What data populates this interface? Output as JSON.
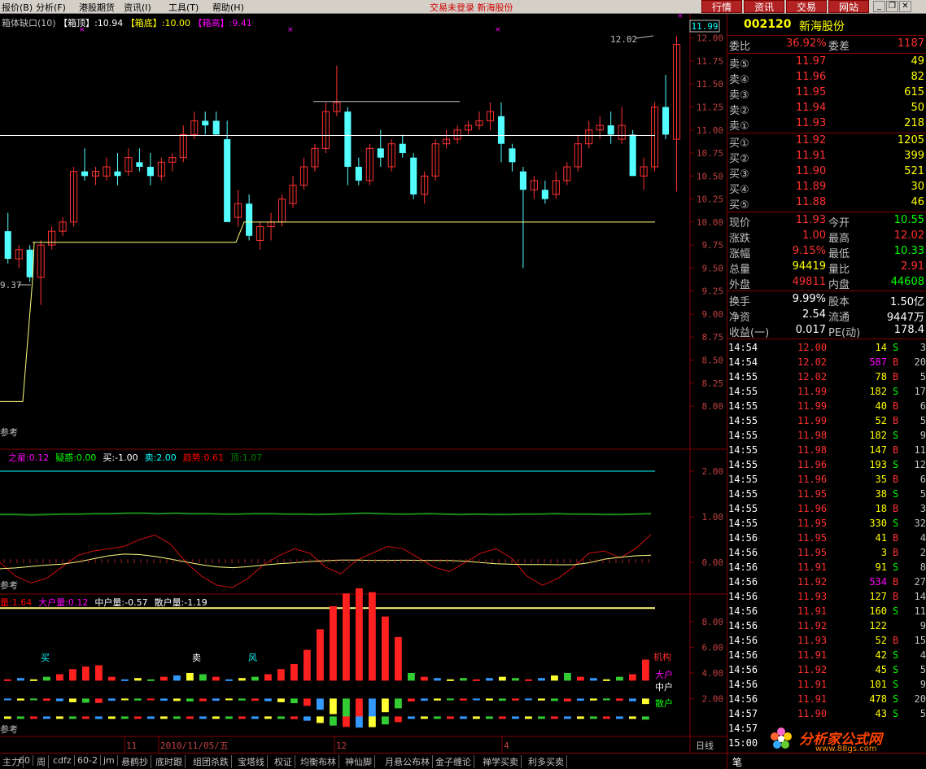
{
  "menu": {
    "items": [
      "报价(B)",
      "分析(F)",
      "港股期货",
      "资讯(I)",
      "工具(T)",
      "帮助(H)"
    ],
    "status_text": "交易未登录  新海股份",
    "top_buttons": [
      "行情",
      "资讯",
      "交易",
      "网站"
    ]
  },
  "main_panel": {
    "legend": {
      "name": "箱体缺口(10)",
      "box_top_label": "【箱顶】",
      "box_top_value": ":10.94",
      "box_bottom_label": "【箱底】",
      "box_bottom_value": ":10.00",
      "box_high_label": "【箱高】",
      "box_high_value": ":9.41"
    },
    "y_ticks": [
      "12.00",
      "11.75",
      "11.50",
      "11.25",
      "11.00",
      "10.75",
      "10.50",
      "10.25",
      "10.00",
      "9.75",
      "9.50",
      "9.25",
      "9.00",
      "8.75",
      "8.50",
      "8.25",
      "8.00"
    ],
    "current_price_tag": "11.99",
    "peak_annotation": "12.02",
    "low_annotation": "9.37",
    "ref_label": "参考"
  },
  "indicator1": {
    "legend": [
      {
        "text": "之星:0.12",
        "color": "#ff00ff"
      },
      {
        "text": "疑惑:0.00",
        "color": "#00ff00"
      },
      {
        "text": "买:-1.00",
        "color": "#ffffff"
      },
      {
        "text": "卖:2.00",
        "color": "#00ffff"
      },
      {
        "text": "趋势:0.61",
        "color": "#ff0000"
      },
      {
        "text": "顶:1.07",
        "color": "#008000"
      }
    ],
    "y_ticks": [
      "2.00",
      "1.00",
      "0.00"
    ],
    "ref_label": "参考"
  },
  "indicator2": {
    "legend": [
      {
        "text": "量:1.64",
        "color": "#ff0000"
      },
      {
        "text": "大户量:0.12",
        "color": "#ff00ff"
      },
      {
        "text": "中户量:-0.57",
        "color": "#ffffff"
      },
      {
        "text": "散户量:-1.19",
        "color": "#ffffff"
      }
    ],
    "y_ticks": [
      "8.00",
      "6.00",
      "4.00",
      "2.00"
    ],
    "labels": {
      "buy": "买",
      "sell": "卖",
      "risk": "风",
      "inst": "机构",
      "big": "大户",
      "mid": "中户",
      "retail": "散户"
    },
    "ref_label": "参考"
  },
  "x_axis": {
    "labels": [
      "11",
      "2010/11/05/五",
      "12",
      "4"
    ],
    "period": "日线"
  },
  "tabs": [
    "主力",
    "60",
    "周",
    "cdfz",
    "60-2",
    "jm",
    "悬鹤抄",
    "底时跟",
    "组团杀跌",
    "宝塔线",
    "权证",
    "均衡布林",
    "神仙脚",
    "月悬公布林",
    "金子缠论",
    "禅学买卖",
    "利多买卖"
  ],
  "quote": {
    "code": "002120",
    "name": "新海股份",
    "weibi_label": "委比",
    "weibi_value": "36.92%",
    "weicha_label": "委差",
    "weicha_value": "1187",
    "asks": [
      {
        "label": "卖⑤",
        "price": "11.97",
        "vol": "49"
      },
      {
        "label": "卖④",
        "price": "11.96",
        "vol": "82"
      },
      {
        "label": "卖③",
        "price": "11.95",
        "vol": "615"
      },
      {
        "label": "卖②",
        "price": "11.94",
        "vol": "50"
      },
      {
        "label": "卖①",
        "price": "11.93",
        "vol": "218"
      }
    ],
    "bids": [
      {
        "label": "买①",
        "price": "11.92",
        "vol": "1205"
      },
      {
        "label": "买②",
        "price": "11.91",
        "vol": "399"
      },
      {
        "label": "买③",
        "price": "11.90",
        "vol": "521"
      },
      {
        "label": "买④",
        "price": "11.89",
        "vol": "30"
      },
      {
        "label": "买⑤",
        "price": "11.88",
        "vol": "46"
      }
    ],
    "stats": [
      {
        "l1": "现价",
        "v1": "11.93",
        "c1": "#ff3030",
        "l2": "今开",
        "v2": "10.55",
        "c2": "#00ff00"
      },
      {
        "l1": "涨跌",
        "v1": "1.00",
        "c1": "#ff3030",
        "l2": "最高",
        "v2": "12.02",
        "c2": "#ff3030"
      },
      {
        "l1": "涨幅",
        "v1": "9.15%",
        "c1": "#ff3030",
        "l2": "最低",
        "v2": "10.33",
        "c2": "#00ff00"
      },
      {
        "l1": "总量",
        "v1": "94419",
        "c1": "#ffff00",
        "l2": "量比",
        "v2": "2.91",
        "c2": "#ff3030"
      },
      {
        "l1": "外盘",
        "v1": "49811",
        "c1": "#ff3030",
        "l2": "内盘",
        "v2": "44608",
        "c2": "#00ff00"
      }
    ],
    "fund": [
      {
        "l1": "换手",
        "v1": "9.99%",
        "l2": "股本",
        "v2": "1.50亿"
      },
      {
        "l1": "净资",
        "v1": "2.54",
        "l2": "流通",
        "v2": "9447万"
      },
      {
        "l1": "收益(一)",
        "v1": "0.017",
        "l2": "PE(动)",
        "v2": "178.4"
      }
    ],
    "ticks": [
      {
        "t": "14:54",
        "p": "12.00",
        "v": "14",
        "vc": "#ffff00",
        "s": "S",
        "sc": "#00ff00",
        "n": "3"
      },
      {
        "t": "14:54",
        "p": "12.02",
        "v": "587",
        "vc": "#ff00ff",
        "s": "B",
        "sc": "#ff3030",
        "n": "20"
      },
      {
        "t": "14:55",
        "p": "12.02",
        "v": "78",
        "vc": "#ffff00",
        "s": "B",
        "sc": "#ff3030",
        "n": "5"
      },
      {
        "t": "14:55",
        "p": "11.99",
        "v": "182",
        "vc": "#ffff00",
        "s": "S",
        "sc": "#00ff00",
        "n": "17"
      },
      {
        "t": "14:55",
        "p": "11.99",
        "v": "40",
        "vc": "#ffff00",
        "s": "B",
        "sc": "#ff3030",
        "n": "6"
      },
      {
        "t": "14:55",
        "p": "11.99",
        "v": "52",
        "vc": "#ffff00",
        "s": "B",
        "sc": "#ff3030",
        "n": "5"
      },
      {
        "t": "14:55",
        "p": "11.98",
        "v": "182",
        "vc": "#ffff00",
        "s": "S",
        "sc": "#00ff00",
        "n": "9"
      },
      {
        "t": "14:55",
        "p": "11.98",
        "v": "147",
        "vc": "#ffff00",
        "s": "B",
        "sc": "#ff3030",
        "n": "11"
      },
      {
        "t": "14:55",
        "p": "11.96",
        "v": "193",
        "vc": "#ffff00",
        "s": "S",
        "sc": "#00ff00",
        "n": "12"
      },
      {
        "t": "14:55",
        "p": "11.96",
        "v": "35",
        "vc": "#ffff00",
        "s": "B",
        "sc": "#ff3030",
        "n": "6"
      },
      {
        "t": "14:55",
        "p": "11.95",
        "v": "38",
        "vc": "#ffff00",
        "s": "S",
        "sc": "#00ff00",
        "n": "5"
      },
      {
        "t": "14:55",
        "p": "11.96",
        "v": "18",
        "vc": "#ffff00",
        "s": "B",
        "sc": "#ff3030",
        "n": "3"
      },
      {
        "t": "14:55",
        "p": "11.95",
        "v": "330",
        "vc": "#ffff00",
        "s": "S",
        "sc": "#00ff00",
        "n": "32"
      },
      {
        "t": "14:56",
        "p": "11.95",
        "v": "41",
        "vc": "#ffff00",
        "s": "B",
        "sc": "#ff3030",
        "n": "4"
      },
      {
        "t": "14:56",
        "p": "11.95",
        "v": "3",
        "vc": "#ffff00",
        "s": "B",
        "sc": "#ff3030",
        "n": "2"
      },
      {
        "t": "14:56",
        "p": "11.91",
        "v": "91",
        "vc": "#ffff00",
        "s": "S",
        "sc": "#00ff00",
        "n": "8"
      },
      {
        "t": "14:56",
        "p": "11.92",
        "v": "534",
        "vc": "#ff00ff",
        "s": "B",
        "sc": "#ff3030",
        "n": "27"
      },
      {
        "t": "14:56",
        "p": "11.93",
        "v": "127",
        "vc": "#ffff00",
        "s": "B",
        "sc": "#ff3030",
        "n": "14"
      },
      {
        "t": "14:56",
        "p": "11.91",
        "v": "160",
        "vc": "#ffff00",
        "s": "S",
        "sc": "#00ff00",
        "n": "11"
      },
      {
        "t": "14:56",
        "p": "11.92",
        "v": "122",
        "vc": "#ffff00",
        "s": "",
        "sc": "#ff3030",
        "n": "9"
      },
      {
        "t": "14:56",
        "p": "11.93",
        "v": "52",
        "vc": "#ffff00",
        "s": "B",
        "sc": "#ff3030",
        "n": "15"
      },
      {
        "t": "14:56",
        "p": "11.91",
        "v": "42",
        "vc": "#ffff00",
        "s": "S",
        "sc": "#00ff00",
        "n": "4"
      },
      {
        "t": "14:56",
        "p": "11.92",
        "v": "45",
        "vc": "#ffff00",
        "s": "S",
        "sc": "#00ff00",
        "n": "5"
      },
      {
        "t": "14:56",
        "p": "11.91",
        "v": "101",
        "vc": "#ffff00",
        "s": "S",
        "sc": "#00ff00",
        "n": "9"
      },
      {
        "t": "14:56",
        "p": "11.91",
        "v": "478",
        "vc": "#ffff00",
        "s": "S",
        "sc": "#00ff00",
        "n": "20"
      },
      {
        "t": "14:57",
        "p": "11.90",
        "v": "43",
        "vc": "#ffff00",
        "s": "S",
        "sc": "#00ff00",
        "n": "5"
      },
      {
        "t": "14:57",
        "p": "",
        "v": "",
        "vc": "#ffff00",
        "s": "",
        "sc": "#00ff00",
        "n": ""
      },
      {
        "t": "15:00",
        "p": "",
        "v": "",
        "vc": "#ffff00",
        "s": "",
        "sc": "#00ff00",
        "n": ""
      }
    ],
    "bottom_tab": "笔"
  },
  "watermark": {
    "text": "分析家公式网",
    "url": "www.88gs.com"
  },
  "chart_data": [
    {
      "type": "candlestick",
      "title": "箱体缺口(10)",
      "ylim": [
        7.85,
        12.05
      ],
      "box_top": 10.94,
      "box_bottom": 10.0,
      "candles": [
        [
          9.9,
          10.1,
          9.55,
          9.6
        ],
        [
          9.6,
          9.75,
          9.5,
          9.7
        ],
        [
          9.7,
          9.75,
          9.35,
          9.4
        ],
        [
          9.4,
          9.8,
          9.1,
          9.75
        ],
        [
          9.75,
          9.95,
          9.7,
          9.9
        ],
        [
          9.9,
          10.05,
          9.85,
          10.0
        ],
        [
          10.0,
          10.6,
          9.95,
          10.55
        ],
        [
          10.55,
          10.8,
          10.45,
          10.5
        ],
        [
          10.5,
          10.6,
          10.4,
          10.55
        ],
        [
          10.5,
          10.7,
          10.45,
          10.6
        ],
        [
          10.55,
          10.75,
          10.4,
          10.5
        ],
        [
          10.55,
          10.8,
          10.5,
          10.7
        ],
        [
          10.65,
          10.8,
          10.55,
          10.6
        ],
        [
          10.6,
          10.75,
          10.4,
          10.5
        ],
        [
          10.5,
          10.7,
          10.45,
          10.65
        ],
        [
          10.65,
          10.75,
          10.55,
          10.7
        ],
        [
          10.7,
          11.05,
          10.65,
          10.95
        ],
        [
          10.95,
          11.2,
          10.9,
          11.1
        ],
        [
          11.1,
          11.2,
          10.95,
          11.05
        ],
        [
          11.1,
          11.2,
          10.95,
          10.95
        ],
        [
          10.9,
          11.1,
          10.05,
          10.0
        ],
        [
          10.05,
          10.35,
          9.95,
          10.2
        ],
        [
          10.2,
          10.3,
          9.8,
          9.85
        ],
        [
          9.8,
          10.0,
          9.7,
          9.95
        ],
        [
          9.95,
          10.1,
          9.8,
          10.0
        ],
        [
          10.0,
          10.3,
          9.95,
          10.25
        ],
        [
          10.2,
          10.5,
          10.15,
          10.4
        ],
        [
          10.4,
          10.7,
          10.35,
          10.6
        ],
        [
          10.6,
          10.85,
          10.55,
          10.8
        ],
        [
          10.8,
          11.3,
          10.75,
          11.2
        ],
        [
          11.2,
          11.7,
          11.15,
          11.3
        ],
        [
          11.2,
          11.25,
          10.4,
          10.6
        ],
        [
          10.6,
          10.7,
          10.4,
          10.45
        ],
        [
          10.45,
          10.85,
          10.4,
          10.8
        ],
        [
          10.8,
          11.0,
          10.6,
          10.7
        ],
        [
          10.6,
          10.9,
          10.55,
          10.85
        ],
        [
          10.85,
          10.95,
          10.7,
          10.75
        ],
        [
          10.7,
          10.75,
          10.25,
          10.3
        ],
        [
          10.3,
          10.55,
          10.2,
          10.5
        ],
        [
          10.5,
          10.9,
          10.45,
          10.85
        ],
        [
          10.85,
          11.0,
          10.8,
          10.9
        ],
        [
          10.9,
          11.05,
          10.85,
          11.0
        ],
        [
          11.0,
          11.1,
          10.95,
          11.05
        ],
        [
          11.05,
          11.2,
          11.0,
          11.1
        ],
        [
          11.1,
          11.3,
          11.0,
          11.2
        ],
        [
          11.15,
          11.3,
          10.65,
          10.85
        ],
        [
          10.8,
          10.85,
          10.55,
          10.65
        ],
        [
          10.55,
          10.6,
          9.5,
          10.35
        ],
        [
          10.35,
          10.5,
          10.25,
          10.45
        ],
        [
          10.35,
          10.45,
          10.2,
          10.25
        ],
        [
          10.3,
          10.55,
          10.25,
          10.45
        ],
        [
          10.45,
          10.65,
          10.4,
          10.6
        ],
        [
          10.6,
          10.95,
          10.55,
          10.85
        ],
        [
          10.85,
          11.1,
          10.8,
          11.0
        ],
        [
          11.0,
          11.15,
          10.9,
          11.05
        ],
        [
          11.05,
          11.2,
          10.85,
          10.95
        ],
        [
          10.9,
          11.25,
          10.85,
          11.05
        ],
        [
          10.95,
          11.0,
          10.5,
          10.5
        ],
        [
          10.5,
          10.7,
          10.35,
          10.6
        ],
        [
          10.6,
          11.3,
          10.55,
          11.25
        ],
        [
          11.25,
          11.6,
          10.9,
          10.95
        ],
        [
          10.9,
          12.02,
          10.33,
          11.93
        ]
      ]
    },
    {
      "type": "line",
      "title": "",
      "ylim": [
        -0.55,
        2.25
      ],
      "series": [
        {
          "name": "顶",
          "values": [
            1.05,
            1.05,
            1.04,
            1.05,
            1.06,
            1.06,
            1.07,
            1.07,
            1.08,
            1.08,
            1.07,
            1.08,
            1.07,
            1.07,
            1.06,
            1.06,
            1.07,
            1.07,
            1.06,
            1.06,
            1.05,
            1.06,
            1.07,
            1.08,
            1.07,
            1.06,
            1.06,
            1.07,
            1.06,
            1.05,
            1.06,
            1.05,
            1.05,
            1.06,
            1.06,
            1.07,
            1.06,
            1.06,
            1.05,
            1.05,
            1.06,
            1.07
          ]
        },
        {
          "name": "趋势",
          "values": [
            0.0,
            -0.3,
            -0.45,
            -0.35,
            -0.1,
            0.15,
            0.25,
            0.3,
            0.35,
            0.5,
            0.6,
            0.4,
            0.0,
            -0.3,
            -0.5,
            -0.55,
            -0.35,
            -0.05,
            0.15,
            0.3,
            0.2,
            -0.1,
            -0.25,
            0.05,
            0.2,
            0.35,
            0.3,
            0.1,
            -0.1,
            -0.2,
            0.0,
            0.2,
            0.3,
            0.1,
            -0.3,
            -0.5,
            -0.35,
            -0.1,
            0.2,
            0.25,
            0.1,
            0.3,
            0.61
          ]
        }
      ]
    },
    {
      "type": "bar",
      "title": "",
      "ylim": [
        0,
        9.2
      ],
      "series": [
        {
          "name": "量",
          "values": [
            0.1,
            0.2,
            0.1,
            0.3,
            0.5,
            0.9,
            1.1,
            1.2,
            0.3,
            0.1,
            0.2,
            0.1,
            0.3,
            0.4,
            0.6,
            0.5,
            0.3,
            0.1,
            0.2,
            0.3,
            0.5,
            0.9,
            1.3,
            2.4,
            4.0,
            5.8,
            6.8,
            7.2,
            6.9,
            5.0,
            3.4,
            0.6,
            0.3,
            0.2,
            0.1,
            0.2,
            0.1,
            0.2,
            0.3,
            0.2,
            0.1,
            0.2,
            0.4,
            0.6,
            0.3,
            0.2,
            0.1,
            0.3,
            0.5,
            1.64
          ]
        }
      ]
    }
  ]
}
